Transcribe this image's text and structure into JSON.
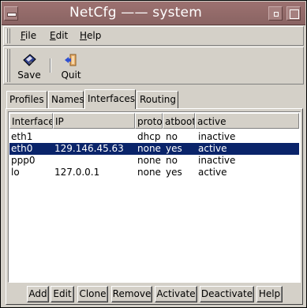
{
  "window": {
    "title": "NetCfg —— system"
  },
  "menu": {
    "file": {
      "mnemonic": "F",
      "rest": "ile"
    },
    "edit": {
      "mnemonic": "E",
      "rest": "dit"
    },
    "help": {
      "mnemonic": "H",
      "rest": "elp"
    }
  },
  "toolbar": {
    "save_label": "Save",
    "quit_label": "Quit",
    "save_icon": "floppy-disk-icon",
    "quit_icon": "exit-door-icon"
  },
  "tabs": [
    {
      "label": "Profiles"
    },
    {
      "label": "Names"
    },
    {
      "label": "Interfaces",
      "selected": true
    },
    {
      "label": "Routing"
    }
  ],
  "table": {
    "columns": [
      "Interface",
      "IP",
      "proto",
      "atboot",
      "active"
    ],
    "rows": [
      {
        "iface": "eth1",
        "ip": "",
        "proto": "dhcp",
        "atboot": "no",
        "active": "inactive",
        "selected": false
      },
      {
        "iface": "eth0",
        "ip": "129.146.45.63",
        "proto": "none",
        "atboot": "yes",
        "active": "active",
        "selected": true
      },
      {
        "iface": "ppp0",
        "ip": "",
        "proto": "none",
        "atboot": "no",
        "active": "inactive",
        "selected": false
      },
      {
        "iface": "lo",
        "ip": "127.0.0.1",
        "proto": "none",
        "atboot": "yes",
        "active": "active",
        "selected": false
      }
    ]
  },
  "buttons": {
    "add": "Add",
    "edit": "Edit",
    "clone": "Clone",
    "remove": "Remove",
    "activate": "Activate",
    "deactivate": "Deactivate",
    "help": "Help"
  },
  "colors": {
    "titlebar": "#9c7170",
    "selection": "#0a246a",
    "face": "#d4d0c8"
  }
}
